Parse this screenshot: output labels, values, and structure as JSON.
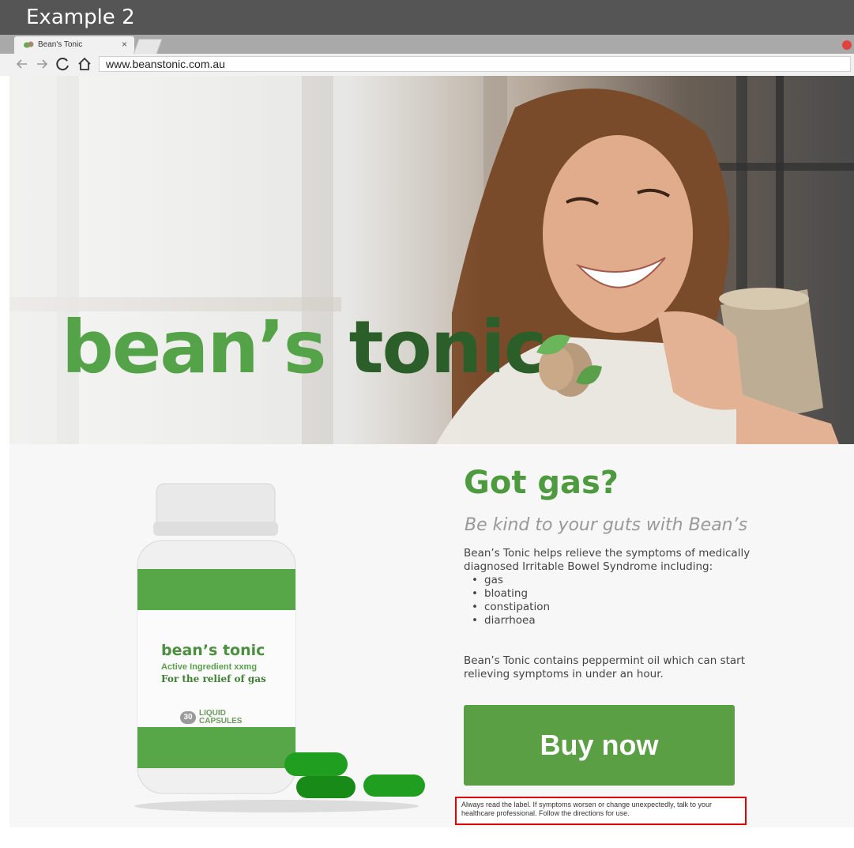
{
  "example_label": "Example 2",
  "browser": {
    "tab_title": "Bean's Tonic",
    "tab_close": "×",
    "url": "www.beanstonic.com.au",
    "nav_icons": [
      "back-arrow-icon",
      "forward-arrow-icon",
      "reload-icon",
      "home-icon"
    ]
  },
  "hero": {
    "brand_part1": "bean’s",
    "brand_part2": "tonic"
  },
  "product": {
    "bottle_brand": "bean’s tonic",
    "bottle_ingredient": "Active Ingredient xxmg",
    "bottle_relief": "For the relief of gas",
    "bottle_count": "30",
    "bottle_caps_line1": "LIQUID",
    "bottle_caps_line2": "CAPSULES"
  },
  "content": {
    "headline": "Got gas?",
    "subhead": "Be kind to your guts with Bean’s",
    "intro": "Bean’s Tonic helps relieve the symptoms of medically diagnosed Irritable Bowel Syndrome including:",
    "symptoms": [
      "gas",
      "bloating",
      "constipation",
      "diarrhoea"
    ],
    "peppermint": "Bean’s Tonic contains peppermint oil which can start relieving symptoms in under an hour.",
    "buy_label": "Buy now",
    "disclaimer": "Always read the label. If symptoms worsen or change unexpectedly, talk to your healthcare professional. Follow the directions for use."
  },
  "colors": {
    "brand_green": "#55a348",
    "brand_dark_green": "#2b5e29",
    "button_green": "#5a9f43",
    "highlight_red": "#e00000"
  }
}
